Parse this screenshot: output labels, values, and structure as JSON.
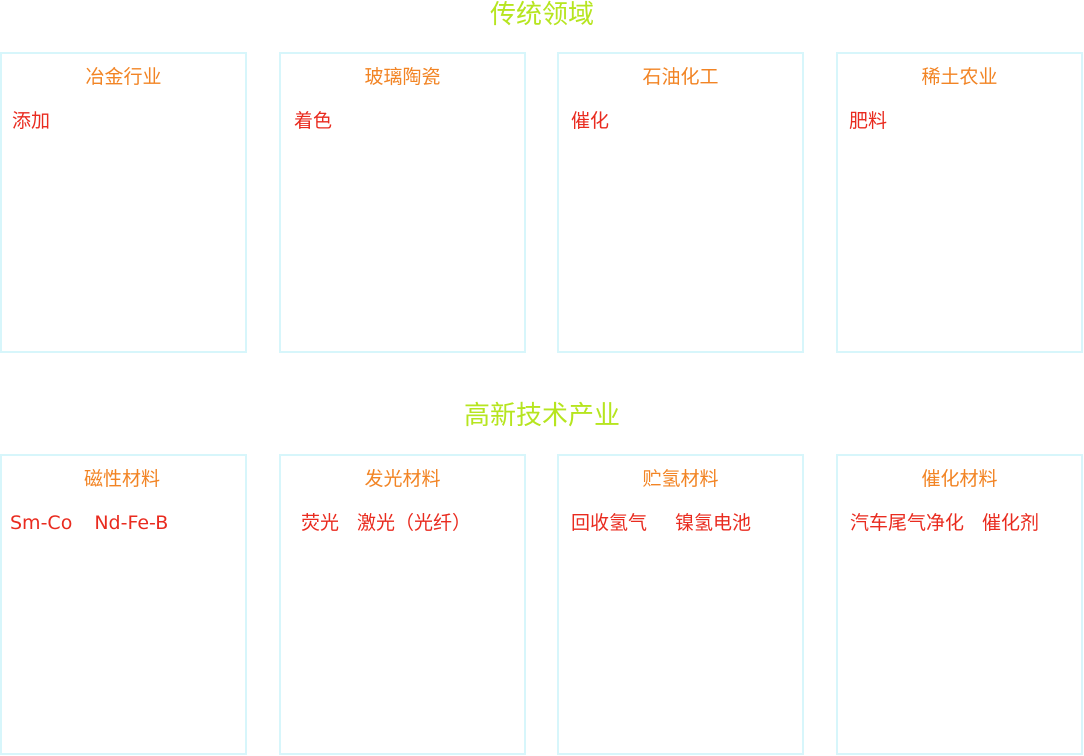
{
  "sections": [
    {
      "title": "传统领域",
      "cards": [
        {
          "title": "冶金行业",
          "items": [
            "添加"
          ]
        },
        {
          "title": "玻璃陶瓷",
          "items": [
            "着色"
          ]
        },
        {
          "title": "石油化工",
          "items": [
            "催化"
          ]
        },
        {
          "title": "稀土农业",
          "items": [
            "肥料"
          ]
        }
      ]
    },
    {
      "title": "高新技术产业",
      "cards": [
        {
          "title": "磁性材料",
          "items": [
            "Sm-Co",
            "Nd-Fe-B"
          ]
        },
        {
          "title": "发光材料",
          "items": [
            "荧光",
            "激光（光纤）"
          ]
        },
        {
          "title": "贮氢材料",
          "items": [
            "回收氢气",
            "镍氢电池"
          ]
        },
        {
          "title": "催化材料",
          "items": [
            "汽车尾气净化",
            "催化剂"
          ]
        }
      ]
    }
  ],
  "colors": {
    "section_title": "#b6e51f",
    "card_title": "#f28424",
    "card_item": "#e92b1f",
    "card_border": "#d7f6fb"
  }
}
